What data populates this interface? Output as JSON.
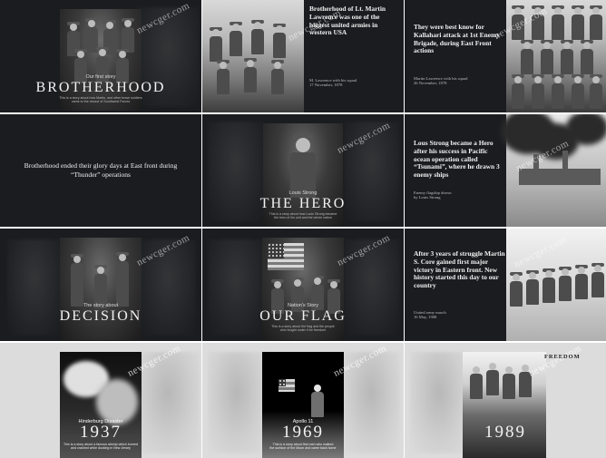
{
  "watermark": "newcger.com",
  "tiles": {
    "t1": {
      "caption": "Our first story",
      "title": "BROTHERHOOD",
      "desc": "This is a story about how Martin, and other brave soldiers\ncame to the rescue of Southwest Forces"
    },
    "t2": {
      "headline": "Brotherhood of Lt. Martin Lawrence was one of the biggest united armies in western USA",
      "meta1": "M. Lawrence with his squad",
      "meta2": "17 November, 1878"
    },
    "t3": {
      "headline": "They were best know for Kallahari attack at 1st Enemy Brigade, during East Front actions",
      "meta1": "Martin Lawrence with his squad",
      "meta2": "26 November, 1878"
    },
    "t4": {
      "headline": "Brotherhood ended their glory days at East front during “Thunder” operations"
    },
    "t5": {
      "caption": "Louis Strong",
      "title": "THE HERO",
      "desc": "This is a story about how Louis Strong became\nthe hero of his unit and the whole nation"
    },
    "t6": {
      "headline": "Lous Strong became a Hero after his success in Pacific ocean operation called “Tsunami”, where he drawn 3 enemy ships",
      "meta1": "Enemy flagship drawn",
      "meta2": "by Louis Strong"
    },
    "t7": {
      "caption": "The story about",
      "title": "DECISION",
      "desc": ""
    },
    "t8": {
      "caption": "Nation's Story",
      "title": "OUR FLAG",
      "desc": "This is a story about the flag and the people\nwho fought under it for freedom"
    },
    "t9": {
      "headline": "After 3 years of struggle Martin S. Core gained first major victory in Eastern front. New history started this day to our country",
      "meta1": "United army march",
      "meta2": "16 May, 1908"
    },
    "t10": {
      "caption": "Hinderburg Disaster",
      "title": "1937",
      "desc": "This is a story about a famous airship which burned\nand crashed while docking in New Jersey"
    },
    "t11": {
      "caption": "Apollo 11",
      "title": "1969",
      "desc": "This is a story about first men who walked\nthe surface of the Moon and came back home"
    },
    "t12": {
      "caption": "",
      "title": "1989",
      "desc": "",
      "sign": "FREEDOM"
    }
  }
}
